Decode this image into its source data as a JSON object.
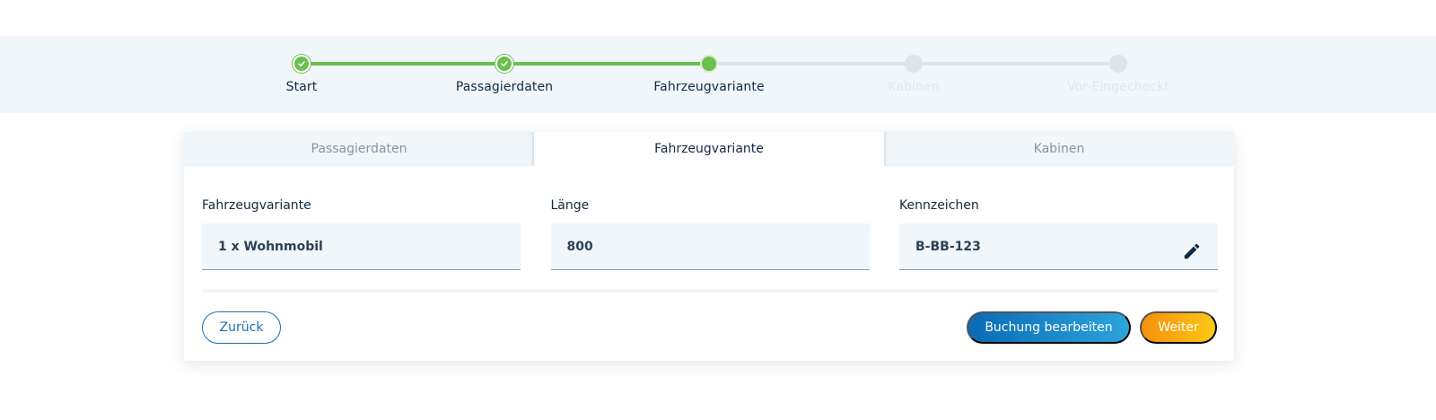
{
  "stepper": {
    "steps": [
      {
        "label": "Start",
        "state": "done"
      },
      {
        "label": "Passagierdaten",
        "state": "done"
      },
      {
        "label": "Fahrzeugvariante",
        "state": "active"
      },
      {
        "label": "Kabinen",
        "state": "todo"
      },
      {
        "label": "Vor-Eingecheckt",
        "state": "todo"
      }
    ],
    "progress_fraction": 0.5
  },
  "tabs": [
    {
      "label": "Passagierdaten",
      "active": false
    },
    {
      "label": "Fahrzeugvariante",
      "active": true
    },
    {
      "label": "Kabinen",
      "active": false
    }
  ],
  "fields": {
    "fahrzeugvariante": {
      "label": "Fahrzeugvariante",
      "value": "1 x Wohnmobil"
    },
    "laenge": {
      "label": "Länge",
      "value": "800"
    },
    "kennzeichen": {
      "label": "Kennzeichen",
      "value": "B-BB-123",
      "icon": "pencil-icon"
    }
  },
  "buttons": {
    "back": "Zurück",
    "edit_booking": "Buchung bearbeiten",
    "next": "Weiter"
  },
  "colors": {
    "accent_green": "#6bbf4e",
    "primary_blue": "#1a6fae",
    "accent_orange": "#f6900a",
    "text_dark": "#0f2a44"
  }
}
